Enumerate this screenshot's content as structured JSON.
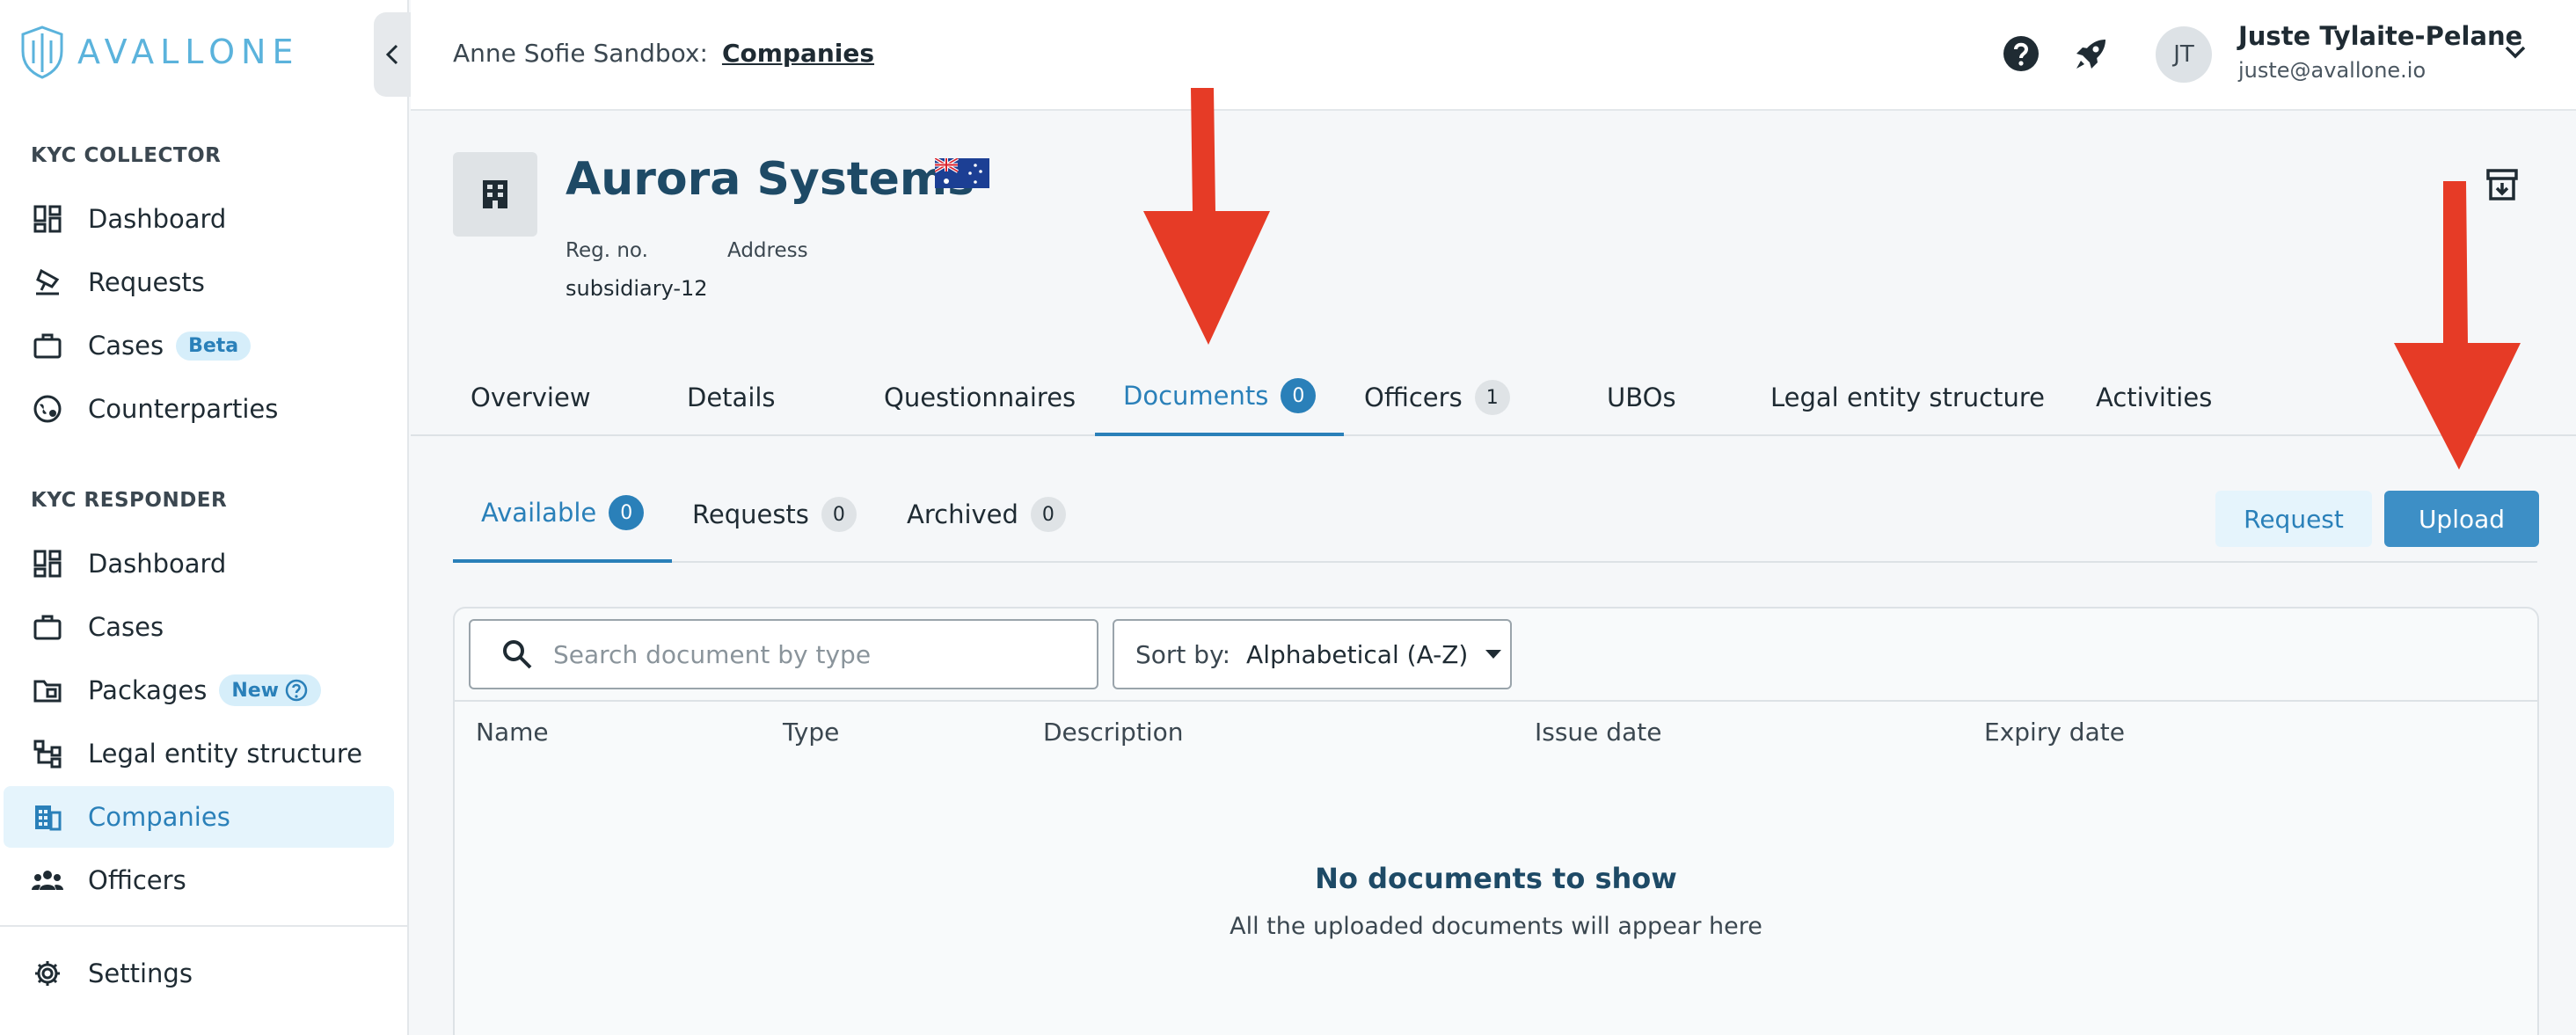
{
  "app": {
    "logo_text": "AVALLONE"
  },
  "sidebar": {
    "collector_title": "KYC COLLECTOR",
    "collector_items": [
      {
        "label": "Dashboard",
        "icon": "dashboard-icon"
      },
      {
        "label": "Requests",
        "icon": "stamp-icon"
      },
      {
        "label": "Cases",
        "icon": "briefcase-icon",
        "badge": "Beta"
      },
      {
        "label": "Counterparties",
        "icon": "globe-icon"
      }
    ],
    "responder_title": "KYC RESPONDER",
    "responder_items": [
      {
        "label": "Dashboard",
        "icon": "dashboard-icon"
      },
      {
        "label": "Cases",
        "icon": "briefcase-icon"
      },
      {
        "label": "Packages",
        "icon": "folder-icon",
        "badge": "New"
      },
      {
        "label": "Legal entity structure",
        "icon": "hierarchy-icon"
      },
      {
        "label": "Companies",
        "icon": "building-icon",
        "active": true
      },
      {
        "label": "Officers",
        "icon": "people-icon"
      }
    ],
    "settings_label": "Settings"
  },
  "header": {
    "workspace": "Anne Sofie Sandbox:",
    "crumb_link": "Companies",
    "user_initials": "JT",
    "user_name": "Juste Tylaite-Pelane",
    "user_email": "juste@avallone.io"
  },
  "company": {
    "name": "Aurora Systems",
    "reg_label": "Reg. no.",
    "reg_value": "subsidiary-12",
    "address_label": "Address"
  },
  "tabs": [
    {
      "label": "Overview"
    },
    {
      "label": "Details"
    },
    {
      "label": "Questionnaires"
    },
    {
      "label": "Documents",
      "count": "0",
      "active": true
    },
    {
      "label": "Officers",
      "count": "1"
    },
    {
      "label": "UBOs"
    },
    {
      "label": "Legal entity structure"
    },
    {
      "label": "Activities"
    }
  ],
  "subtabs": [
    {
      "label": "Available",
      "count": "0",
      "active": true
    },
    {
      "label": "Requests",
      "count": "0"
    },
    {
      "label": "Archived",
      "count": "0"
    }
  ],
  "actions": {
    "request_label": "Request",
    "upload_label": "Upload"
  },
  "documents": {
    "search_placeholder": "Search document by type",
    "sort_label": "Sort by:",
    "sort_value": "Alphabetical (A-Z)",
    "columns": [
      "Name",
      "Type",
      "Description",
      "Issue date",
      "Expiry date"
    ],
    "empty_title": "No documents to show",
    "empty_subtitle": "All the uploaded documents will appear here"
  },
  "colors": {
    "accent": "#2a80b9",
    "annotation_arrow": "#e63b26"
  }
}
